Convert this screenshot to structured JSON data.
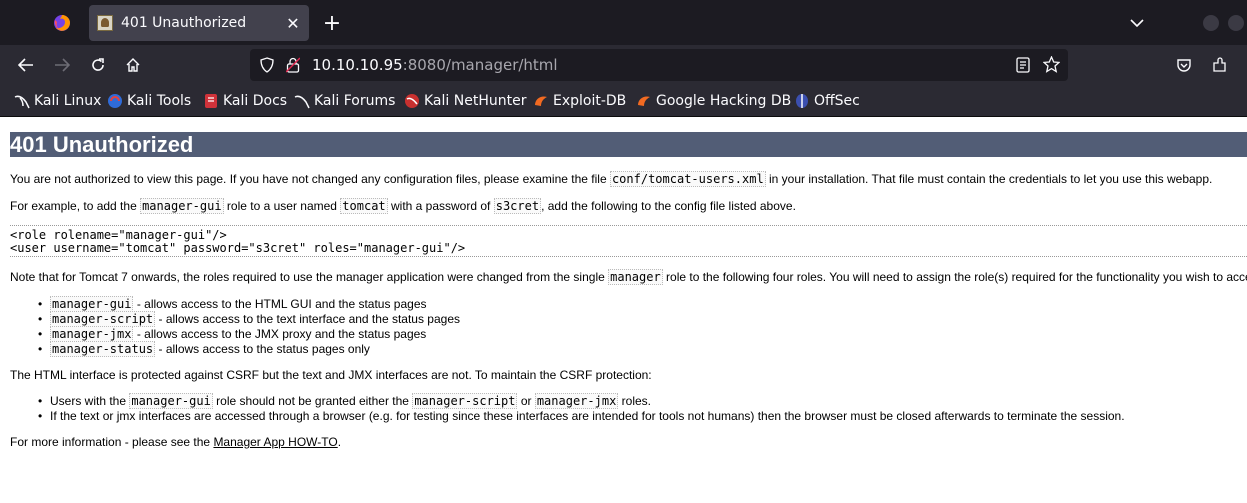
{
  "browser": {
    "tab_title": "401 Unauthorized",
    "url_host": "10.10.10.95",
    "url_rest": ":8080/manager/html"
  },
  "bookmarks": [
    {
      "label": "Kali Linux",
      "icon": "kali-dragon-icon"
    },
    {
      "label": "Kali Tools",
      "icon": "kali-tools-icon"
    },
    {
      "label": "Kali Docs",
      "icon": "kali-docs-icon"
    },
    {
      "label": "Kali Forums",
      "icon": "kali-forums-icon"
    },
    {
      "label": "Kali NetHunter",
      "icon": "nethunter-icon"
    },
    {
      "label": "Exploit-DB",
      "icon": "exploit-db-icon"
    },
    {
      "label": "Google Hacking DB",
      "icon": "ghdb-icon"
    },
    {
      "label": "OffSec",
      "icon": "offsec-icon"
    }
  ],
  "page": {
    "heading": "401 Unauthorized",
    "p1_a": "You are not authorized to view this page. If you have not changed any configuration files, please examine the file ",
    "p1_code": "conf/tomcat-users.xml",
    "p1_b": " in your installation. That file must contain the credentials to let you use this webapp.",
    "p2_a": "For example, to add the ",
    "p2_code1": "manager-gui",
    "p2_b": " role to a user named ",
    "p2_code2": "tomcat",
    "p2_c": " with a password of ",
    "p2_code3": "s3cret",
    "p2_d": ", add the following to the config file listed above.",
    "pre_line1": "<role rolename=\"manager-gui\"/>",
    "pre_line2": "<user username=\"tomcat\" password=\"s3cret\" roles=\"manager-gui\"/>",
    "p3_a": "Note that for Tomcat 7 onwards, the roles required to use the manager application were changed from the single ",
    "p3_code": "manager",
    "p3_b": " role to the following four roles. You will need to assign the role(s) required for the functionality you wish to acce",
    "roles": [
      {
        "code": "manager-gui",
        "text": " - allows access to the HTML GUI and the status pages"
      },
      {
        "code": "manager-script",
        "text": " - allows access to the text interface and the status pages"
      },
      {
        "code": "manager-jmx",
        "text": " - allows access to the JMX proxy and the status pages"
      },
      {
        "code": "manager-status",
        "text": " - allows access to the status pages only"
      }
    ],
    "p4": "The HTML interface is protected against CSRF but the text and JMX interfaces are not. To maintain the CSRF protection:",
    "csrf1_a": "Users with the ",
    "csrf1_code1": "manager-gui",
    "csrf1_b": " role should not be granted either the ",
    "csrf1_code2": "manager-script",
    "csrf1_c": " or ",
    "csrf1_code3": "manager-jmx",
    "csrf1_d": " roles.",
    "csrf2": "If the text or jmx interfaces are accessed through a browser (e.g. for testing since these interfaces are intended for tools not humans) then the browser must be closed afterwards to terminate the session.",
    "p5_a": "For more information - please see the ",
    "p5_link": "Manager App HOW-TO",
    "p5_b": "."
  }
}
